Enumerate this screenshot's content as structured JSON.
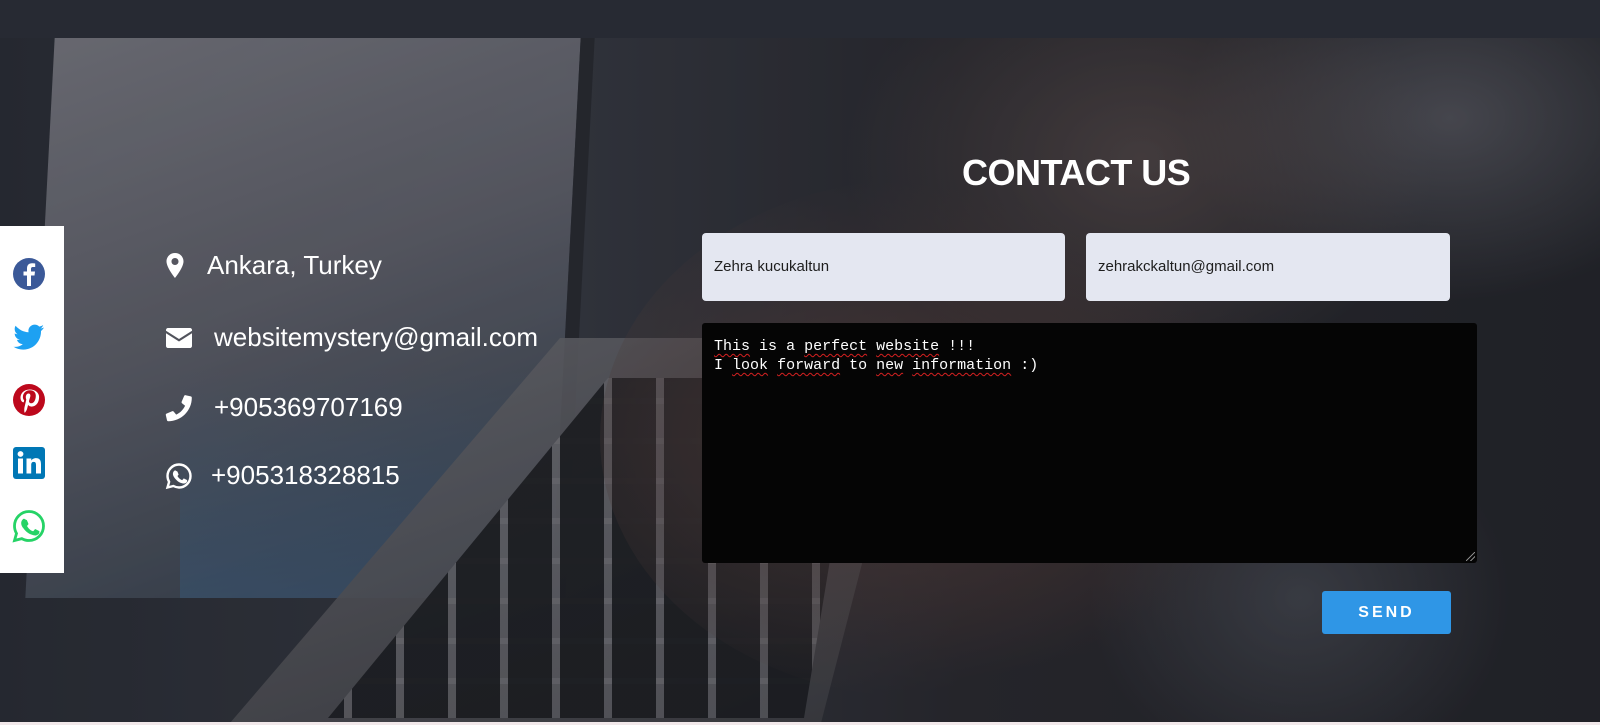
{
  "contact": {
    "title": "CONTACT US",
    "info": {
      "address": "Ankara, Turkey",
      "email": "websitemystery@gmail.com",
      "phone": "+905369707169",
      "whatsapp": "+905318328815"
    },
    "form": {
      "name_value": "Zehra kucukaltun",
      "email_value": "zehrakckaltun@gmail.com",
      "message_line1_words": [
        "This",
        "is",
        "a",
        "perfect",
        "website",
        "!!!"
      ],
      "message_line2_words": [
        "I",
        "look",
        "forward",
        "to",
        "new",
        "information",
        ":)"
      ],
      "send_label": "SEND"
    }
  },
  "share_bar": {
    "icons": [
      "facebook-icon",
      "twitter-icon",
      "pinterest-icon",
      "linkedin-icon",
      "whatsapp-icon"
    ]
  },
  "colors": {
    "topbar": "#272a33",
    "send_button": "#2f96e6",
    "field_background": "#e4e7f1",
    "message_background": "#050505",
    "facebook": "#3b5998",
    "twitter": "#1da1f2",
    "pinterest": "#bd081c",
    "linkedin": "#0077b5",
    "whatsapp": "#25d366"
  }
}
